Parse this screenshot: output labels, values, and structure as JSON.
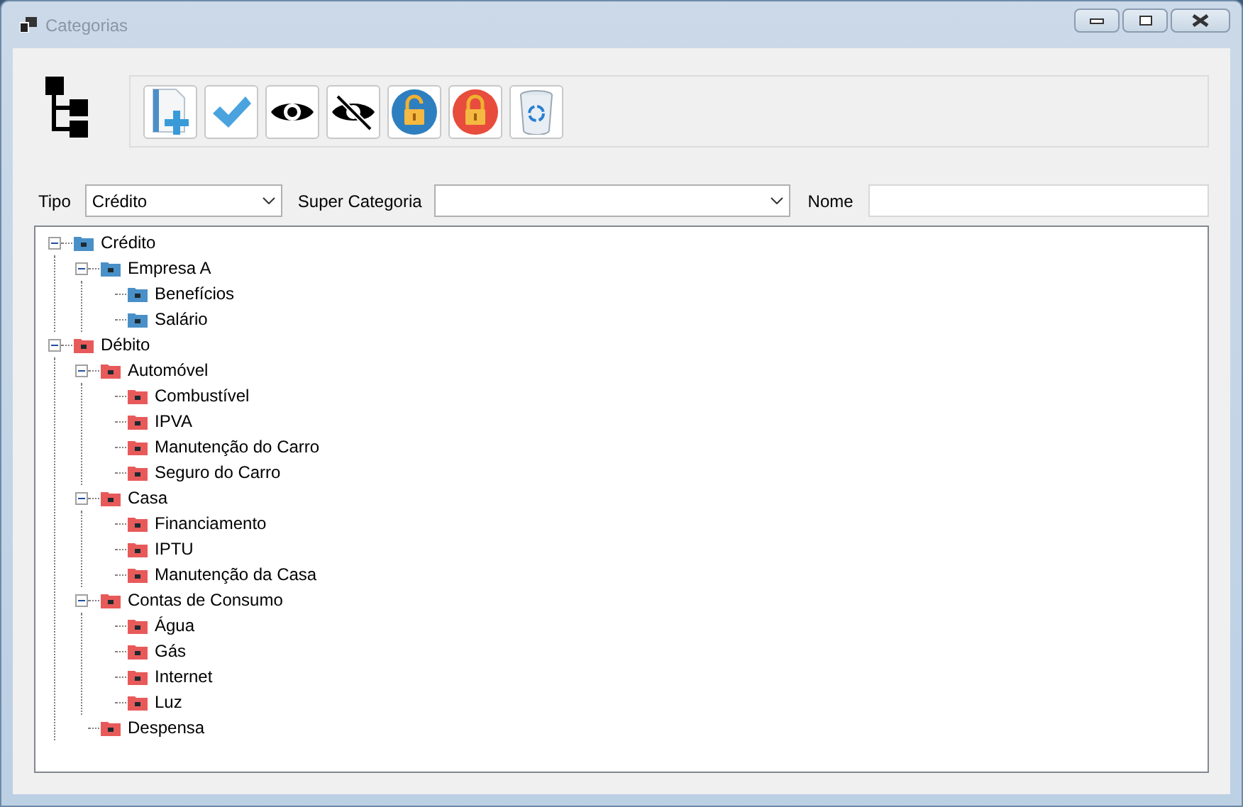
{
  "window": {
    "title": "Categorias"
  },
  "toolbar": [
    {
      "kind": "new"
    },
    {
      "kind": "confirm"
    },
    {
      "kind": "show"
    },
    {
      "kind": "hide"
    },
    {
      "kind": "unlock"
    },
    {
      "kind": "lock"
    },
    {
      "kind": "trash"
    }
  ],
  "filters": {
    "tipo": {
      "label": "Tipo",
      "value": "Crédito"
    },
    "super_categoria": {
      "label": "Super Categoria"
    },
    "nome": {
      "label": "Nome"
    }
  },
  "tree": [
    {
      "label": "Crédito",
      "color": "#4a90c8",
      "expanded": true,
      "children": [
        {
          "label": "Empresa A",
          "color": "#4a90c8",
          "expanded": true,
          "children": [
            {
              "label": "Benefícios",
              "color": "#4a90c8"
            },
            {
              "label": "Salário",
              "color": "#4a90c8"
            }
          ]
        }
      ]
    },
    {
      "label": "Débito",
      "color": "#e85a5a",
      "expanded": true,
      "children": [
        {
          "label": "Automóvel",
          "color": "#e85a5a",
          "expanded": true,
          "children": [
            {
              "label": "Combustível",
              "color": "#e85a5a"
            },
            {
              "label": "IPVA",
              "color": "#e85a5a"
            },
            {
              "label": "Manutenção do Carro",
              "color": "#e85a5a"
            },
            {
              "label": "Seguro do Carro",
              "color": "#e85a5a"
            }
          ]
        },
        {
          "label": "Casa",
          "color": "#e85a5a",
          "expanded": true,
          "children": [
            {
              "label": "Financiamento",
              "color": "#e85a5a"
            },
            {
              "label": "IPTU",
              "color": "#e85a5a"
            },
            {
              "label": "Manutenção da Casa",
              "color": "#e85a5a"
            }
          ]
        },
        {
          "label": "Contas de Consumo",
          "color": "#e85a5a",
          "expanded": true,
          "children": [
            {
              "label": "Água",
              "color": "#e85a5a"
            },
            {
              "label": "Gás",
              "color": "#e85a5a"
            },
            {
              "label": "Internet",
              "color": "#e85a5a"
            },
            {
              "label": "Luz",
              "color": "#e85a5a"
            }
          ]
        },
        {
          "label": "Despensa",
          "color": "#e85a5a"
        }
      ]
    }
  ]
}
